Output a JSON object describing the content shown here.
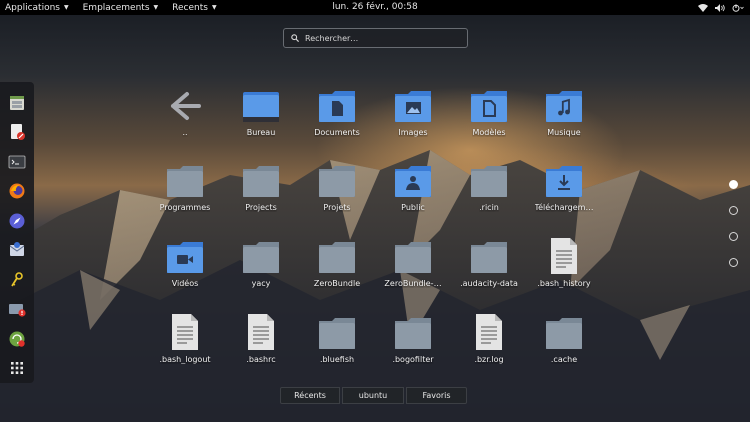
{
  "topbar": {
    "menus": [
      {
        "label": "Applications"
      },
      {
        "label": "Emplacements"
      },
      {
        "label": "Recents"
      }
    ],
    "clock": "lun. 26 févr., 00:58",
    "tray_icons": [
      "wifi-icon",
      "volume-icon",
      "power-icon"
    ]
  },
  "search": {
    "placeholder": "Rechercher…"
  },
  "dock": {
    "items": [
      {
        "name": "dock-files-manager",
        "icon": "file-cabinet-icon"
      },
      {
        "name": "dock-text-editor",
        "icon": "document-edit-icon"
      },
      {
        "name": "dock-terminal",
        "icon": "terminal-icon"
      },
      {
        "name": "dock-firefox",
        "icon": "firefox-icon"
      },
      {
        "name": "dock-web-browser",
        "icon": "compass-icon"
      },
      {
        "name": "dock-mail",
        "icon": "mail-icon"
      },
      {
        "name": "dock-passwords",
        "icon": "keys-icon"
      },
      {
        "name": "dock-screen-alert",
        "icon": "monitor-alert-icon"
      },
      {
        "name": "dock-software-updater",
        "icon": "update-icon"
      },
      {
        "name": "dock-show-apps",
        "icon": "app-grid-icon"
      }
    ]
  },
  "grid": {
    "items": [
      {
        "label": "..",
        "icon": "back-arrow"
      },
      {
        "label": "Bureau",
        "icon": "desktop-folder"
      },
      {
        "label": "Documents",
        "icon": "documents-folder"
      },
      {
        "label": "Images",
        "icon": "pictures-folder"
      },
      {
        "label": "Modèles",
        "icon": "templates-folder"
      },
      {
        "label": "Musique",
        "icon": "music-folder"
      },
      {
        "label": "Programmes",
        "icon": "folder"
      },
      {
        "label": "Projects",
        "icon": "folder"
      },
      {
        "label": "Projets",
        "icon": "folder"
      },
      {
        "label": "Public",
        "icon": "public-folder"
      },
      {
        "label": ".ricin",
        "icon": "folder"
      },
      {
        "label": "Téléchargem…",
        "icon": "downloads-folder"
      },
      {
        "label": "Vidéos",
        "icon": "videos-folder"
      },
      {
        "label": "yacy",
        "icon": "folder"
      },
      {
        "label": "ZeroBundle",
        "icon": "folder"
      },
      {
        "label": "ZeroBundle-…",
        "icon": "folder"
      },
      {
        "label": ".audacity-data",
        "icon": "folder"
      },
      {
        "label": ".bash_history",
        "icon": "text-file"
      },
      {
        "label": ".bash_logout",
        "icon": "text-file"
      },
      {
        "label": ".bashrc",
        "icon": "text-file"
      },
      {
        "label": ".bluefish",
        "icon": "folder"
      },
      {
        "label": ".bogofilter",
        "icon": "folder"
      },
      {
        "label": ".bzr.log",
        "icon": "text-file"
      },
      {
        "label": ".cache",
        "icon": "folder"
      }
    ]
  },
  "pages": {
    "count": 4,
    "active": 1
  },
  "tabs": [
    {
      "label": "Récents"
    },
    {
      "label": "ubuntu"
    },
    {
      "label": "Favoris"
    }
  ],
  "colors": {
    "folder_blue": "#4a90d9",
    "folder_grey": "#8b9aa8",
    "topbar": "#000000"
  }
}
